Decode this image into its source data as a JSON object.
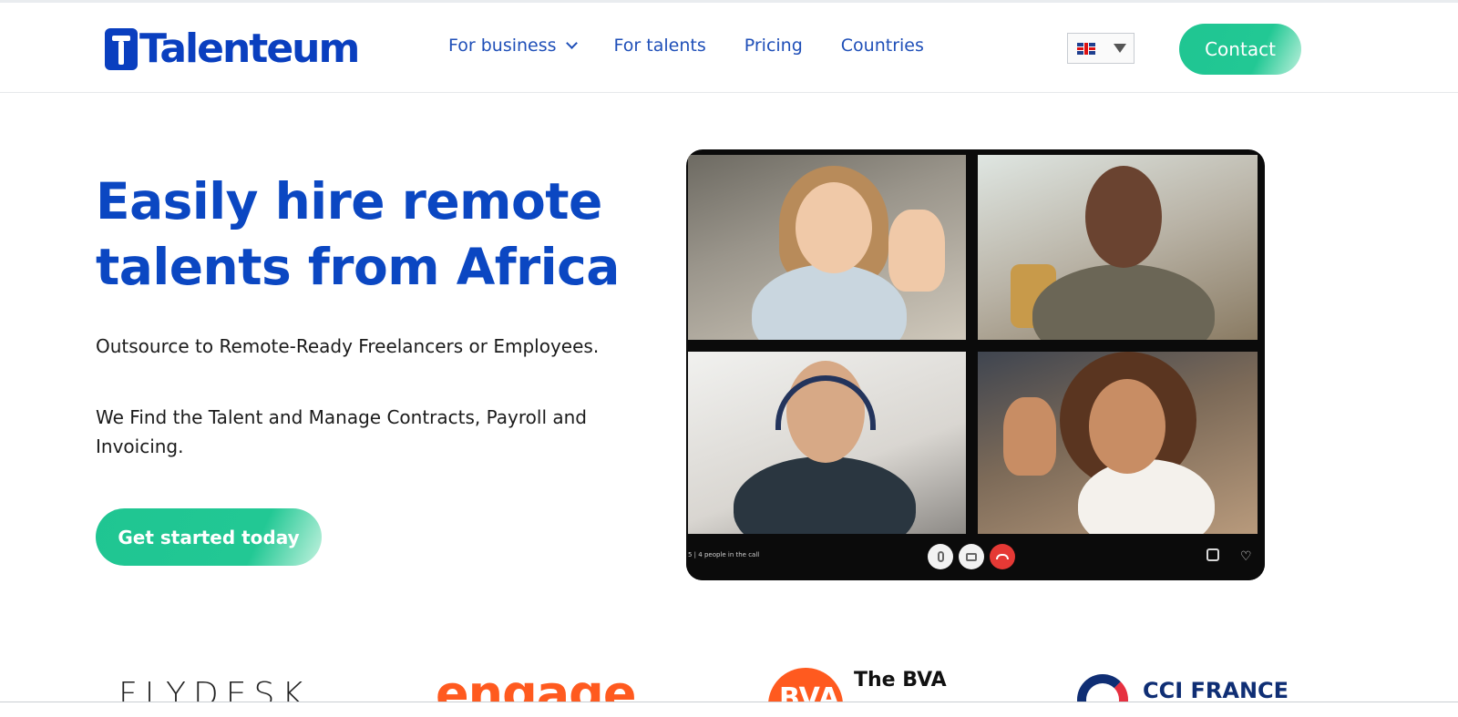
{
  "header": {
    "logo_text": "Talenteum",
    "nav": [
      {
        "label": "For business",
        "has_dropdown": true
      },
      {
        "label": "For talents"
      },
      {
        "label": "Pricing"
      },
      {
        "label": "Countries"
      }
    ],
    "language": {
      "selected": "English",
      "flag": "uk-flag-icon"
    },
    "contact_label": "Contact"
  },
  "hero": {
    "title_line1": "Easily hire remote",
    "title_line2": "talents from Africa",
    "paragraph1": "Outsource to Remote-Ready Freelancers or Employees.",
    "paragraph2": "We Find the Talent and Manage Contracts, Payroll and Invoicing.",
    "cta_label": "Get started today"
  },
  "video_call": {
    "status_text": "5 | 4 people in the call",
    "controls": [
      "microphone-icon",
      "camera-icon",
      "hang-up-icon",
      "focus-icon",
      "heart-icon"
    ]
  },
  "partners": [
    {
      "name": "FLYDESK"
    },
    {
      "name": "engage"
    },
    {
      "name": "BVA",
      "text": "The BVA"
    },
    {
      "name": "CCI FRANCE"
    }
  ],
  "colors": {
    "brand_blue": "#0b47c2",
    "nav_blue": "#1f4fb8",
    "accent_green": "#22c894"
  }
}
